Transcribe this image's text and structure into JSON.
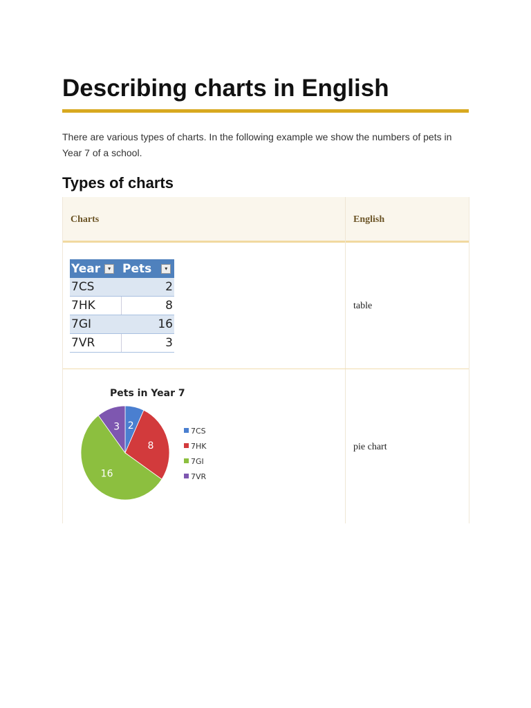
{
  "title": "Describing charts in English",
  "intro": "There are various types of charts. In the following example we show the numbers of pets in Year 7 of a school.",
  "subtitle": "Types of charts",
  "table": {
    "headers": [
      "Charts",
      "English"
    ],
    "rows": [
      {
        "english": "table"
      },
      {
        "english": "pie chart"
      }
    ]
  },
  "excel_table": {
    "headers": [
      "Year",
      "Pets"
    ],
    "rows": [
      [
        "7CS",
        "2"
      ],
      [
        "7HK",
        "8"
      ],
      [
        "7GI",
        "16"
      ],
      [
        "7VR",
        "3"
      ]
    ]
  },
  "chart_data": {
    "type": "pie",
    "title": "Pets in Year 7",
    "categories": [
      "7CS",
      "7HK",
      "7GI",
      "7VR"
    ],
    "values": [
      2,
      8,
      16,
      3
    ],
    "colors": [
      "#4a7fd0",
      "#d23a3c",
      "#8cbf3f",
      "#7e57b0"
    ],
    "legend": "right"
  }
}
